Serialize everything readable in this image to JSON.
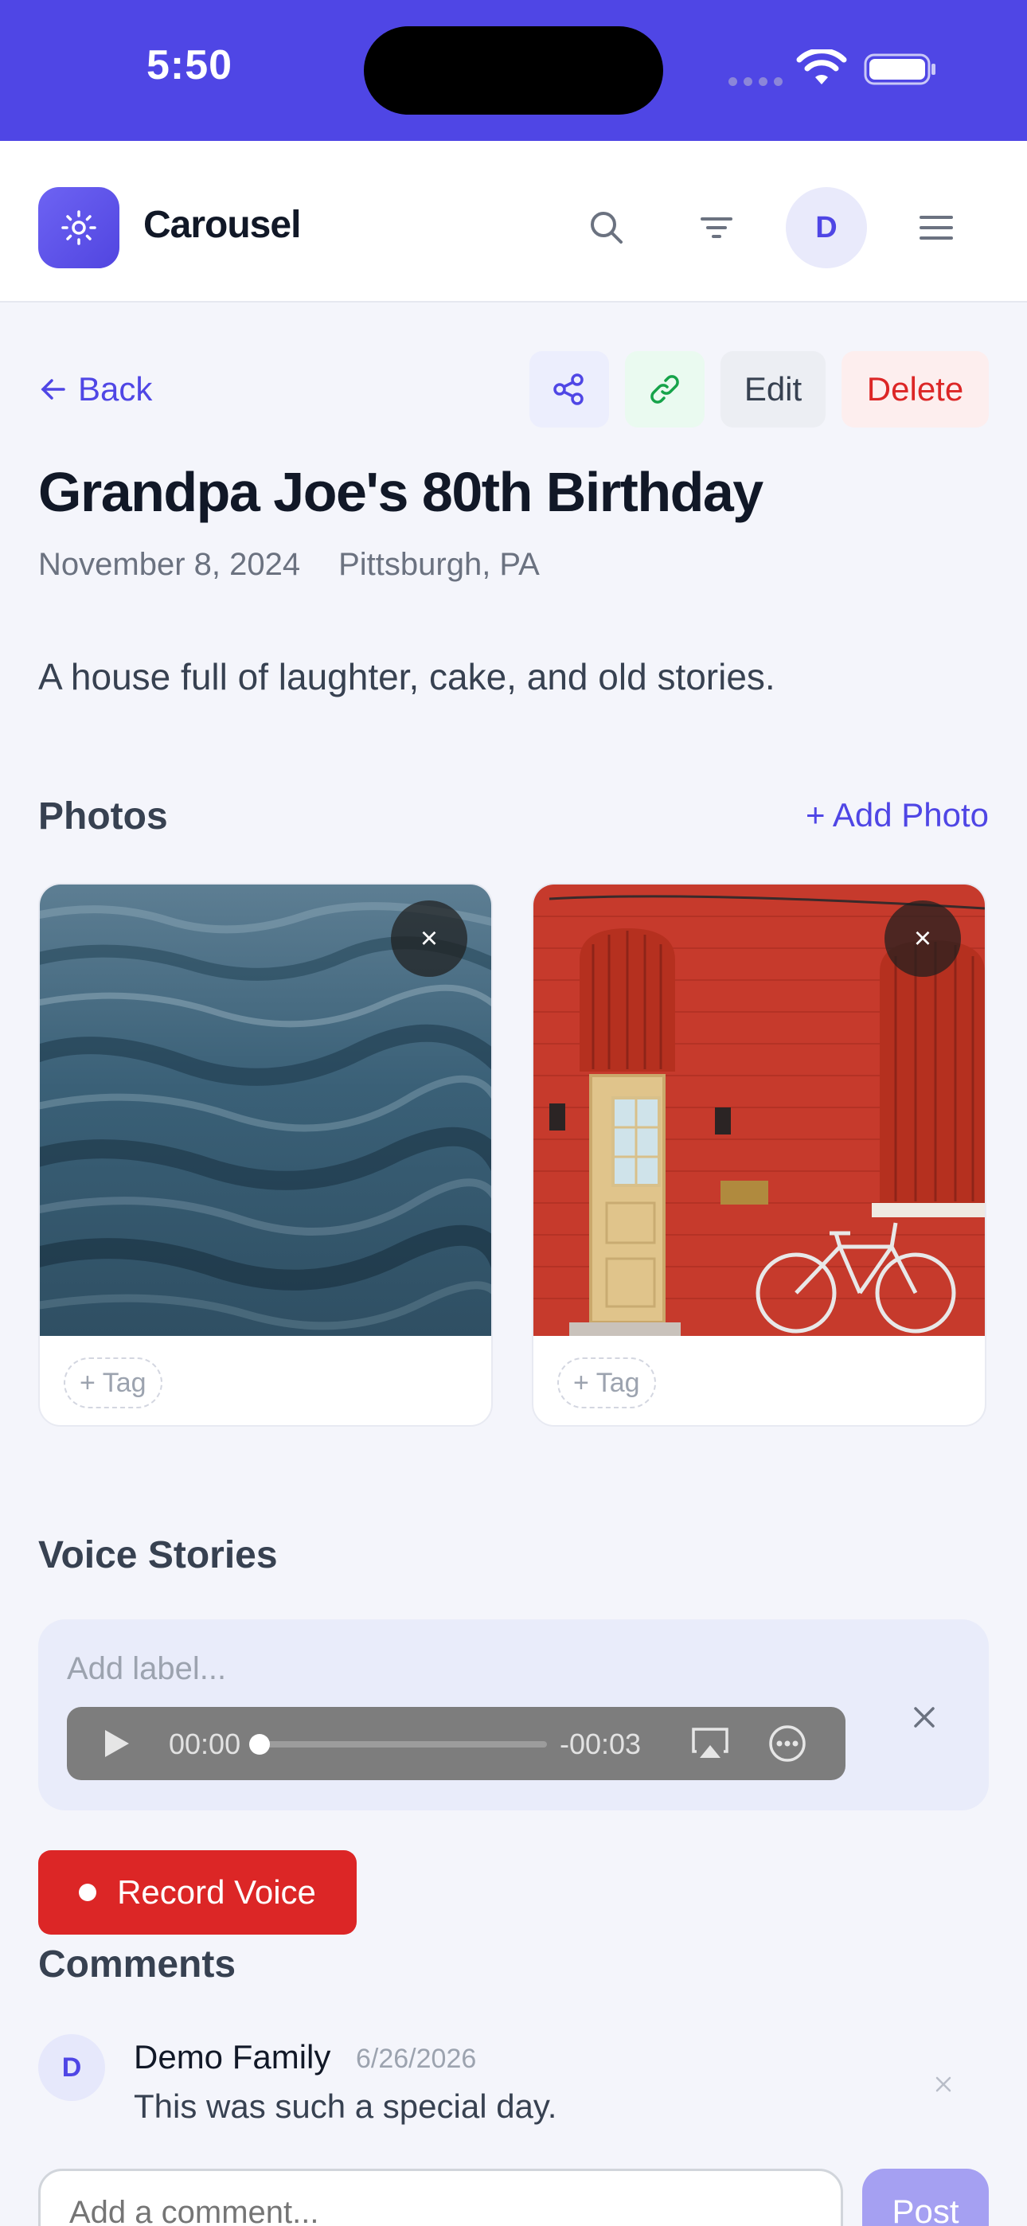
{
  "status_bar": {
    "time": "5:50"
  },
  "header": {
    "app_title": "Carousel",
    "avatar_initial": "D"
  },
  "actions": {
    "back_label": "Back",
    "edit_label": "Edit",
    "delete_label": "Delete"
  },
  "event": {
    "title": "Grandpa Joe's 80th Birthday",
    "date": "November 8, 2024",
    "location": "Pittsburgh, PA",
    "description": "A house full of laughter, cake, and old stories."
  },
  "photos": {
    "section_title": "Photos",
    "add_label": "+ Add Photo",
    "items": [
      {
        "tag_label": "+ Tag",
        "remove_icon": "×"
      },
      {
        "tag_label": "+ Tag",
        "remove_icon": "×"
      }
    ]
  },
  "voice": {
    "section_title": "Voice Stories",
    "label_placeholder": "Add label...",
    "current_time": "00:00",
    "remaining_time": "-00:03",
    "progress": 0,
    "record_label": "Record Voice"
  },
  "comments": {
    "section_title": "Comments",
    "items": [
      {
        "initial": "D",
        "author": "Demo Family",
        "date": "6/26/2026",
        "text": "This was such a special day."
      }
    ],
    "input_placeholder": "Add a comment...",
    "post_label": "Post"
  },
  "colors": {
    "accent": "#4f46e5",
    "danger": "#dc2626",
    "status_bar": "#4f46e5",
    "share_bg": "#eceefd",
    "link_bg": "#eafaf0",
    "delete_bg": "#fdeeee"
  }
}
